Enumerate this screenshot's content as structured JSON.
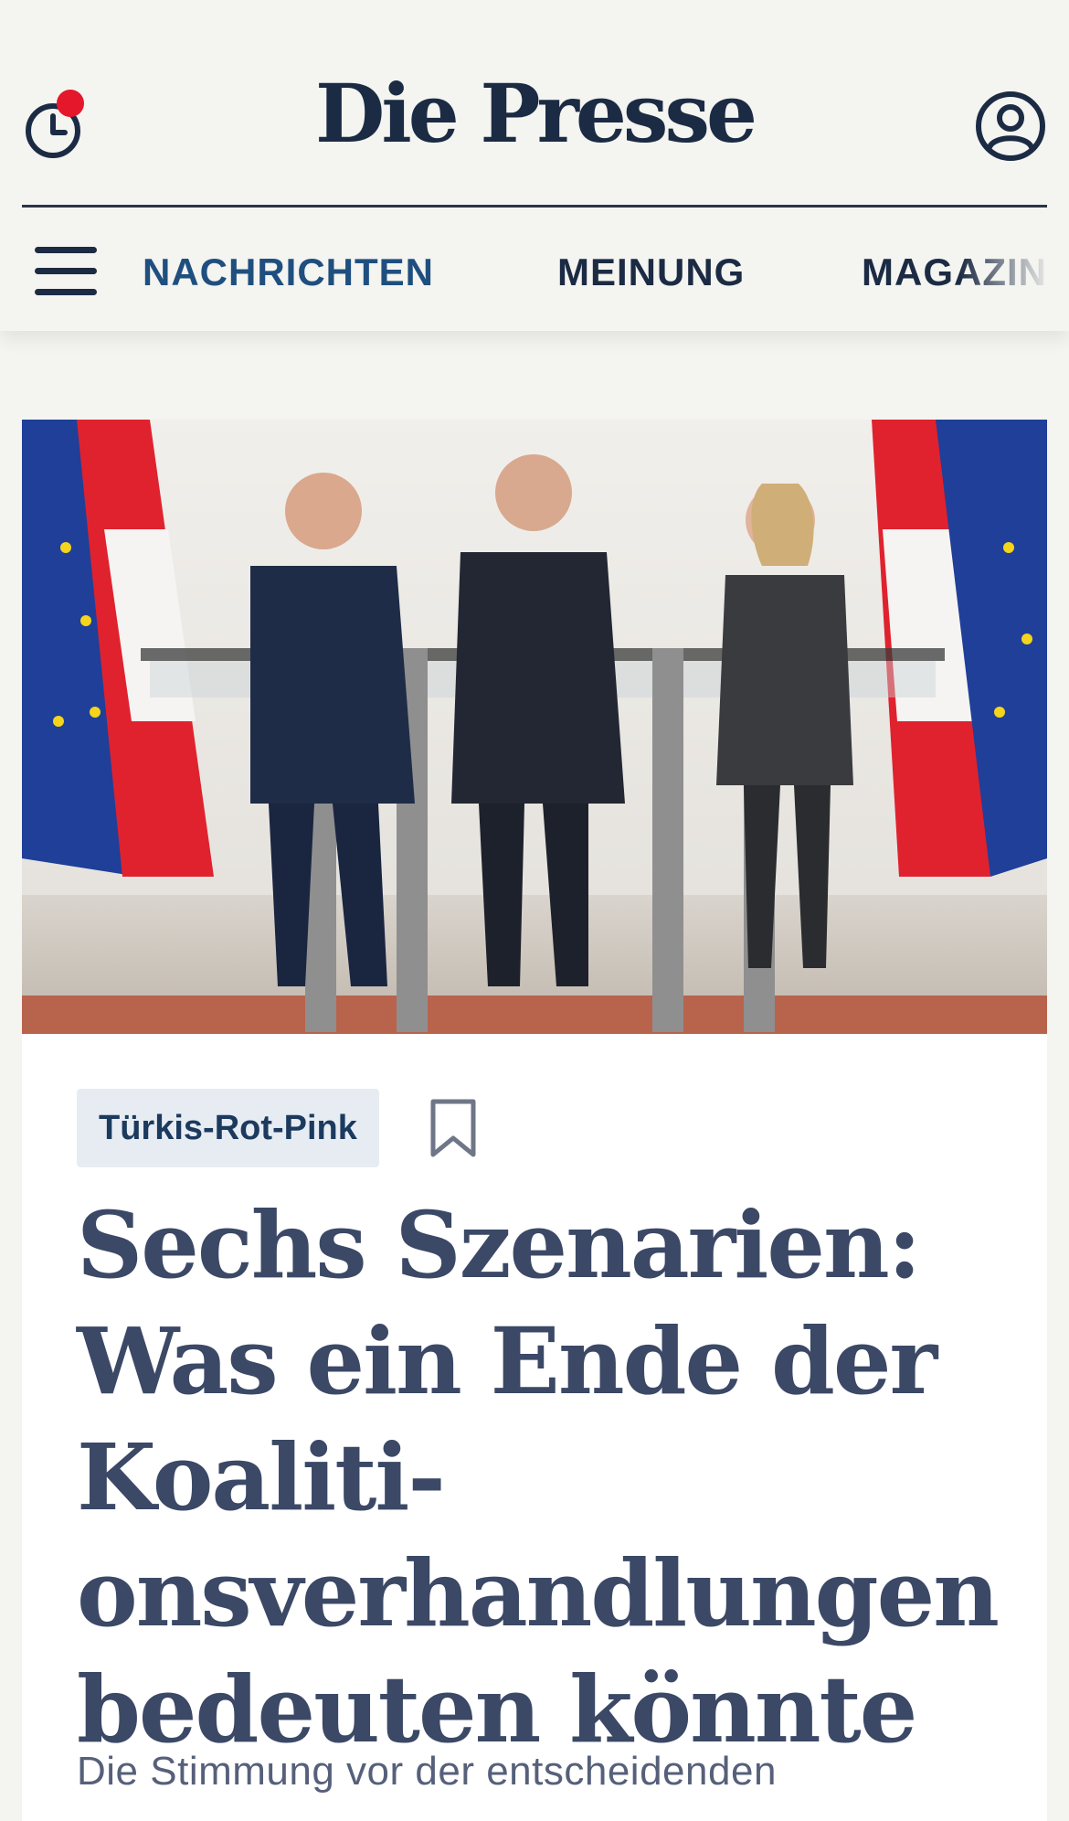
{
  "header": {
    "logo": "Die Presse",
    "history_icon": "clock-notification-icon",
    "account_icon": "user-account-icon",
    "menu_icon": "hamburger-menu-icon",
    "nav": [
      {
        "label": "NACHRICHTEN",
        "active": true
      },
      {
        "label": "MEINUNG",
        "active": false
      },
      {
        "label": "MAGAZIN",
        "active": false
      }
    ]
  },
  "article": {
    "image_description_icon": "press-conference-photo",
    "tag": "Türkis-Rot-Pink",
    "bookmark_icon": "bookmark-icon",
    "headline": "Sechs Szenarien: Was ein Ende der Koaliti­onsverhandlungen bedeuten könnte",
    "teaser": "Die Stimmung vor der entscheidenden Verhandlungsrunde von Türkis-Rot-Pink"
  },
  "colors": {
    "brand_navy": "#1c2b44",
    "active_nav": "#1f4f7f",
    "notification_dot": "#e4172b",
    "tag_background": "#e7ecf3",
    "headline": "#3b4866"
  }
}
